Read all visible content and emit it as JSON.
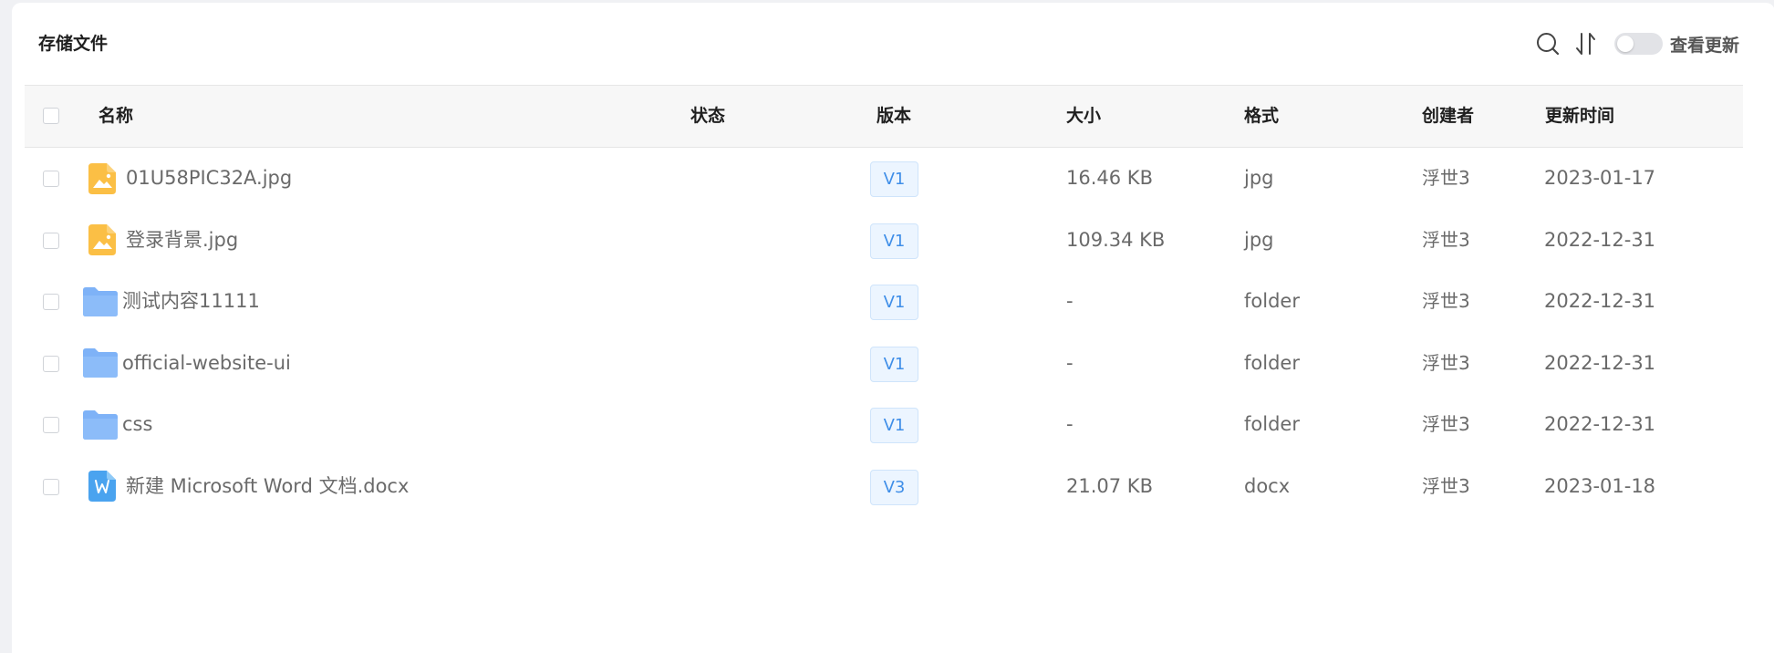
{
  "title": "存储文件",
  "toolbar": {
    "search_icon": "search-icon",
    "sort_icon": "sort-icon",
    "toggle_label": "查看更新",
    "toggle_on": false
  },
  "columns": {
    "name": "名称",
    "status": "状态",
    "version": "版本",
    "size": "大小",
    "format": "格式",
    "creator": "创建者",
    "updated": "更新时间"
  },
  "rows": [
    {
      "icon": "image-file-icon",
      "name": "01U58PIC32A.jpg",
      "status": "",
      "version": "V1",
      "size": "16.46 KB",
      "format": "jpg",
      "creator": "浮世3",
      "updated": "2023-01-17"
    },
    {
      "icon": "image-file-icon",
      "name": "登录背景.jpg",
      "status": "",
      "version": "V1",
      "size": "109.34 KB",
      "format": "jpg",
      "creator": "浮世3",
      "updated": "2022-12-31"
    },
    {
      "icon": "folder-icon",
      "name": "测试内容11111",
      "status": "",
      "version": "V1",
      "size": "-",
      "format": "folder",
      "creator": "浮世3",
      "updated": "2022-12-31"
    },
    {
      "icon": "folder-icon",
      "name": "official-website-ui",
      "status": "",
      "version": "V1",
      "size": "-",
      "format": "folder",
      "creator": "浮世3",
      "updated": "2022-12-31"
    },
    {
      "icon": "folder-icon",
      "name": "css",
      "status": "",
      "version": "V1",
      "size": "-",
      "format": "folder",
      "creator": "浮世3",
      "updated": "2022-12-31"
    },
    {
      "icon": "word-file-icon",
      "name": "新建 Microsoft Word 文档.docx",
      "status": "",
      "version": "V3",
      "size": "21.07 KB",
      "format": "docx",
      "creator": "浮世3",
      "updated": "2023-01-18"
    }
  ],
  "colors": {
    "accent": "#3f8ee8",
    "tag_bg": "#ecf5ff",
    "folder": "#7eb2f7",
    "image": "#fbbf45",
    "word": "#4aa3ef"
  }
}
